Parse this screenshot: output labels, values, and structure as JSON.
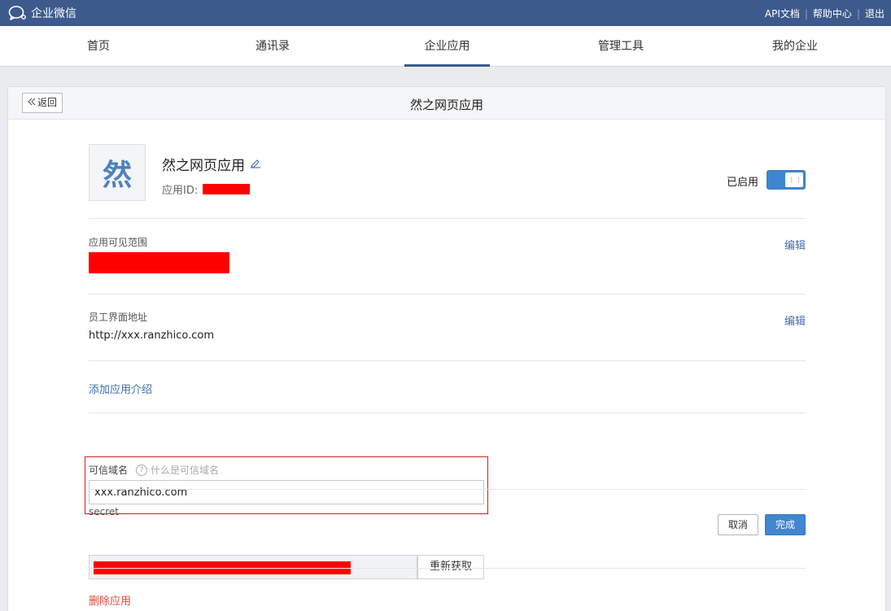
{
  "topbar": {
    "title": "企业微信",
    "links": [
      "API文档",
      "帮助中心",
      "退出"
    ]
  },
  "nav": {
    "items": [
      "首页",
      "通讯录",
      "企业应用",
      "管理工具",
      "我的企业"
    ],
    "active": "企业应用"
  },
  "panel": {
    "back_label": "返回",
    "title": "然之网页应用"
  },
  "app": {
    "avatar_char": "然",
    "name": "然之网页应用",
    "id_label": "应用ID:",
    "status_label": "已启用",
    "enabled": true
  },
  "visibility": {
    "label": "应用可见范围",
    "edit_label": "编辑"
  },
  "employee_url": {
    "label": "员工界面地址",
    "value": "http://xxx.ranzhico.com",
    "edit_label": "编辑"
  },
  "add_intro_label": "添加应用介绍",
  "trusted_domain": {
    "label": "可信域名",
    "help_label": "什么是可信域名",
    "value": "xxx.ranzhico.com",
    "cancel_label": "取消",
    "done_label": "完成"
  },
  "secret": {
    "label": "secret",
    "refresh_label": "重新获取"
  },
  "delete_label": "删除应用",
  "colors": {
    "topbar": "#3c5a8c",
    "link": "#3f6ea8",
    "primary_button": "#4186d1",
    "danger": "#e0493d",
    "redaction": "#ff0000"
  }
}
